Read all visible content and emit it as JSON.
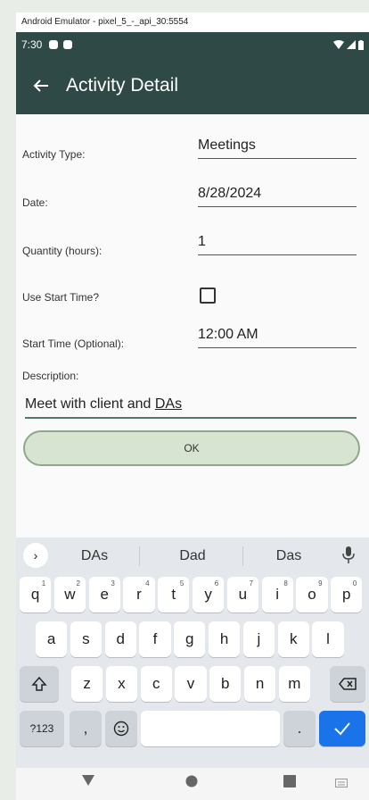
{
  "window": {
    "title": "Android Emulator - pixel_5_-_api_30:5554"
  },
  "status_bar": {
    "time": "7:30"
  },
  "app_bar": {
    "title": "Activity Detail"
  },
  "form": {
    "activity_type": {
      "label": "Activity Type:",
      "value": "Meetings"
    },
    "date": {
      "label": "Date:",
      "value": "8/28/2024"
    },
    "quantity": {
      "label": "Quantity (hours):",
      "value": "1"
    },
    "use_start_time": {
      "label": "Use Start Time?",
      "checked": false
    },
    "start_time": {
      "label": "Start Time (Optional):",
      "value": "12:00 AM"
    },
    "description": {
      "label": "Description:",
      "value_prefix": "Meet with client and ",
      "value_last_word": "DAs"
    },
    "ok_button": "OK"
  },
  "keyboard": {
    "suggestions": [
      "DAs",
      "Dad",
      "Das"
    ],
    "row1": [
      {
        "k": "q",
        "n": "1"
      },
      {
        "k": "w",
        "n": "2"
      },
      {
        "k": "e",
        "n": "3"
      },
      {
        "k": "r",
        "n": "4"
      },
      {
        "k": "t",
        "n": "5"
      },
      {
        "k": "y",
        "n": "6"
      },
      {
        "k": "u",
        "n": "7"
      },
      {
        "k": "i",
        "n": "8"
      },
      {
        "k": "o",
        "n": "9"
      },
      {
        "k": "p",
        "n": "0"
      }
    ],
    "row2": [
      "a",
      "s",
      "d",
      "f",
      "g",
      "h",
      "j",
      "k",
      "l"
    ],
    "row3": [
      "z",
      "x",
      "c",
      "v",
      "b",
      "n",
      "m"
    ],
    "symbols_key": "?123",
    "comma_key": ",",
    "period_key": "."
  }
}
